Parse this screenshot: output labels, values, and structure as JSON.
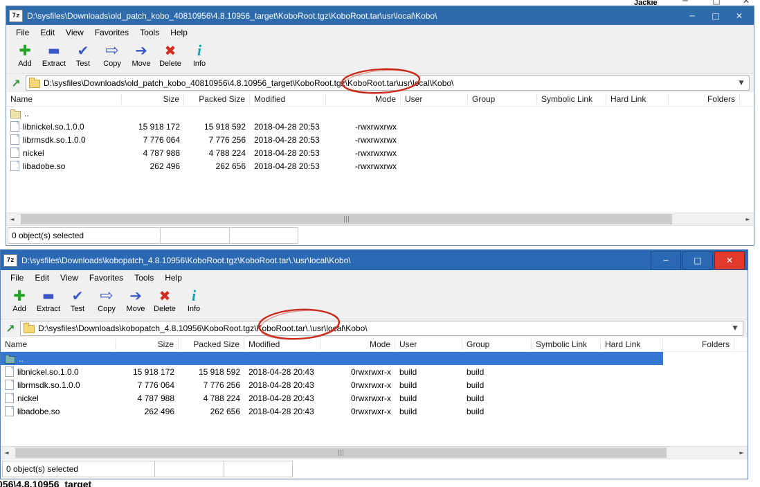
{
  "chrome": {
    "user_label": "Jackie",
    "bottom_partial_text": "056\\4.8.10956_target",
    "window_controls": {
      "minimize": "─",
      "maximize": "□",
      "close": "✕"
    }
  },
  "colors": {
    "titlebar_blue": "#2e6bac",
    "titlebar_active_blue": "#2b69b4",
    "selection_blue": "#3577d4",
    "close_button_red": "#e23b2e",
    "annotation_red": "#cb2b1d"
  },
  "win1": {
    "icon_label": "7z",
    "title": "D:\\sysfiles\\Downloads\\old_patch_kobo_40810956\\4.8.10956_target\\KoboRoot.tgz\\KoboRoot.tar\\usr\\local\\Kobo\\",
    "menu": [
      "File",
      "Edit",
      "View",
      "Favorites",
      "Tools",
      "Help"
    ],
    "toolbar": [
      "Add",
      "Extract",
      "Test",
      "Copy",
      "Move",
      "Delete",
      "Info"
    ],
    "address": "D:\\sysfiles\\Downloads\\old_patch_kobo_40810956\\4.8.10956_target\\KoboRoot.tgz\\KoboRoot.tar\\usr\\local\\Kobo\\",
    "columns": [
      "Name",
      "Size",
      "Packed Size",
      "Modified",
      "Mode",
      "User",
      "Group",
      "Symbolic Link",
      "Hard Link",
      "Folders"
    ],
    "rows": [
      {
        "name": "..",
        "size": "",
        "packed": "",
        "modified": "",
        "mode": "",
        "user": "",
        "group": ""
      },
      {
        "name": "libnickel.so.1.0.0",
        "size": "15 918 172",
        "packed": "15 918 592",
        "modified": "2018-04-28 20:53",
        "mode": "-rwxrwxrwx",
        "user": "",
        "group": ""
      },
      {
        "name": "librmsdk.so.1.0.0",
        "size": "7 776 064",
        "packed": "7 776 256",
        "modified": "2018-04-28 20:53",
        "mode": "-rwxrwxrwx",
        "user": "",
        "group": ""
      },
      {
        "name": "nickel",
        "size": "4 787 988",
        "packed": "4 788 224",
        "modified": "2018-04-28 20:53",
        "mode": "-rwxrwxrwx",
        "user": "",
        "group": ""
      },
      {
        "name": "libadobe.so",
        "size": "262 496",
        "packed": "262 656",
        "modified": "2018-04-28 20:53",
        "mode": "-rwxrwxrwx",
        "user": "",
        "group": ""
      }
    ],
    "status": "0 object(s) selected"
  },
  "win2": {
    "icon_label": "7z",
    "title": "D:\\sysfiles\\Downloads\\kobopatch_4.8.10956\\KoboRoot.tgz\\KoboRoot.tar\\.\\usr\\local\\Kobo\\",
    "menu": [
      "File",
      "Edit",
      "View",
      "Favorites",
      "Tools",
      "Help"
    ],
    "toolbar": [
      "Add",
      "Extract",
      "Test",
      "Copy",
      "Move",
      "Delete",
      "Info"
    ],
    "address": "D:\\sysfiles\\Downloads\\kobopatch_4.8.10956\\KoboRoot.tgz\\KoboRoot.tar\\.\\usr\\local\\Kobo\\",
    "columns": [
      "Name",
      "Size",
      "Packed Size",
      "Modified",
      "Mode",
      "User",
      "Group",
      "Symbolic Link",
      "Hard Link",
      "Folders"
    ],
    "rows": [
      {
        "name": "..",
        "size": "",
        "packed": "",
        "modified": "",
        "mode": "",
        "user": "",
        "group": ""
      },
      {
        "name": "libnickel.so.1.0.0",
        "size": "15 918 172",
        "packed": "15 918 592",
        "modified": "2018-04-28 20:43",
        "mode": "0rwxrwxr-x",
        "user": "build",
        "group": "build"
      },
      {
        "name": "librmsdk.so.1.0.0",
        "size": "7 776 064",
        "packed": "7 776 256",
        "modified": "2018-04-28 20:43",
        "mode": "0rwxrwxr-x",
        "user": "build",
        "group": "build"
      },
      {
        "name": "nickel",
        "size": "4 787 988",
        "packed": "4 788 224",
        "modified": "2018-04-28 20:43",
        "mode": "0rwxrwxr-x",
        "user": "build",
        "group": "build"
      },
      {
        "name": "libadobe.so",
        "size": "262 496",
        "packed": "262 656",
        "modified": "2018-04-28 20:43",
        "mode": "0rwxrwxr-x",
        "user": "build",
        "group": "build"
      }
    ],
    "status": "0 object(s) selected"
  }
}
